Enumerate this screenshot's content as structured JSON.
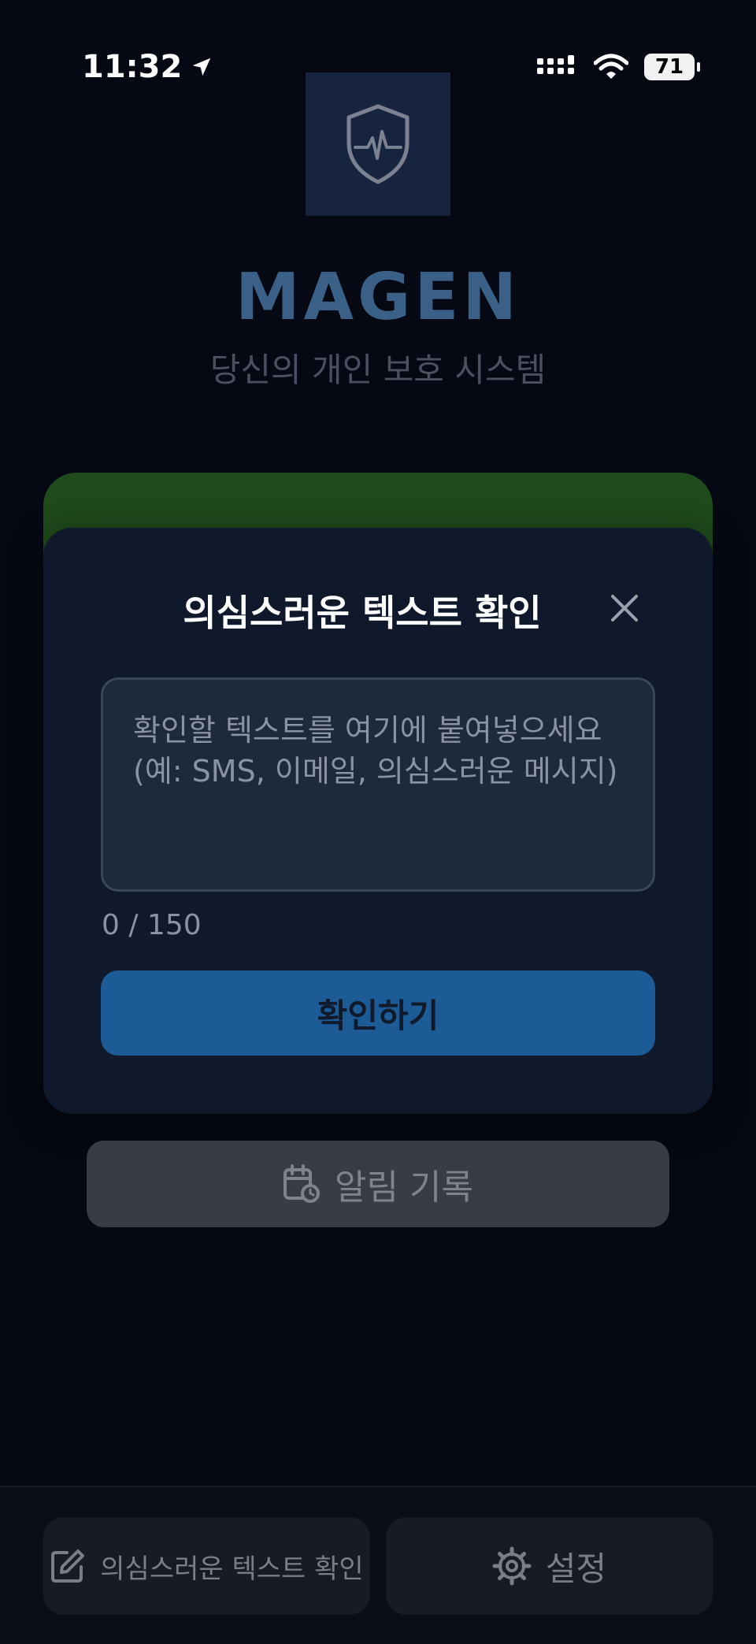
{
  "status_bar": {
    "time": "11:32",
    "battery": "71"
  },
  "app": {
    "title": "MAGEN",
    "subtitle": "당신의 개인 보호 시스템",
    "logo_icon": "shield-pulse-icon"
  },
  "modal": {
    "title": "의심스러운 텍스트 확인",
    "input_placeholder": "확인할 텍스트를 여기에 붙여넣으세요 (예: SMS, 이메일, 의심스러운 메시지)",
    "input_value": "",
    "counter": "0 / 150",
    "confirm_label": "확인하기",
    "confirm_color": "#1c5b96"
  },
  "history_button": {
    "label": "알림 기록",
    "icon": "calendar-clock-icon"
  },
  "tabbar": {
    "tabs": [
      {
        "label": "의심스러운 텍스트 확인",
        "icon": "edit-icon"
      },
      {
        "label": "설정",
        "icon": "gear-icon"
      }
    ]
  },
  "colors": {
    "background": "#060913",
    "modal": "#0f192b",
    "accent_green": "#1e4a1c",
    "title_blue": "#3a6088"
  }
}
